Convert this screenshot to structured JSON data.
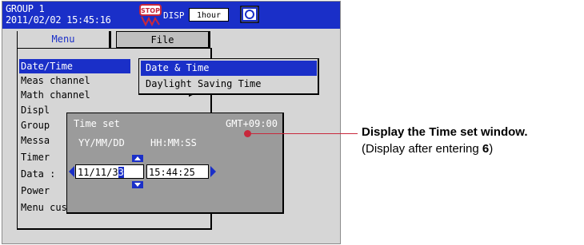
{
  "header": {
    "group": "GROUP 1",
    "datetime": "2011/02/02 15:45:16",
    "disp_label": "DISP",
    "hour_box": "1hour",
    "stop_icon": "stop-icon",
    "right_icon": "display-icon"
  },
  "tabs": [
    {
      "label": "Menu"
    },
    {
      "label": "File"
    }
  ],
  "menu": {
    "items": [
      {
        "label": "Date/Time"
      },
      {
        "label": "Meas channel"
      },
      {
        "label": "Math channel"
      },
      {
        "label": "Displ"
      },
      {
        "label": "Group"
      },
      {
        "label": "Messa"
      },
      {
        "label": "Timer"
      },
      {
        "label": "Data :"
      },
      {
        "label": "Power"
      },
      {
        "label": "Menu customize"
      }
    ]
  },
  "submenu": {
    "items": [
      {
        "label": "Date & Time"
      },
      {
        "label": "Daylight Saving Time"
      }
    ]
  },
  "timeset": {
    "title": "Time set",
    "gmt": "GMT+09:00",
    "date_format": "YY/MM/DD",
    "time_format": "HH:MM:SS",
    "date_value_prefix": "11/11/3",
    "date_value_cursor": "3",
    "time_value": "15:44:25"
  },
  "annotation": {
    "main": "Display the Time set window.",
    "sub_prefix": "(Display after entering ",
    "sub_bold": "6",
    "sub_suffix": ")"
  },
  "colors": {
    "accent": "#1a2fc8",
    "callout": "#c8283c",
    "panel": "#d6d6d6",
    "dialog": "#9b9b9b"
  }
}
